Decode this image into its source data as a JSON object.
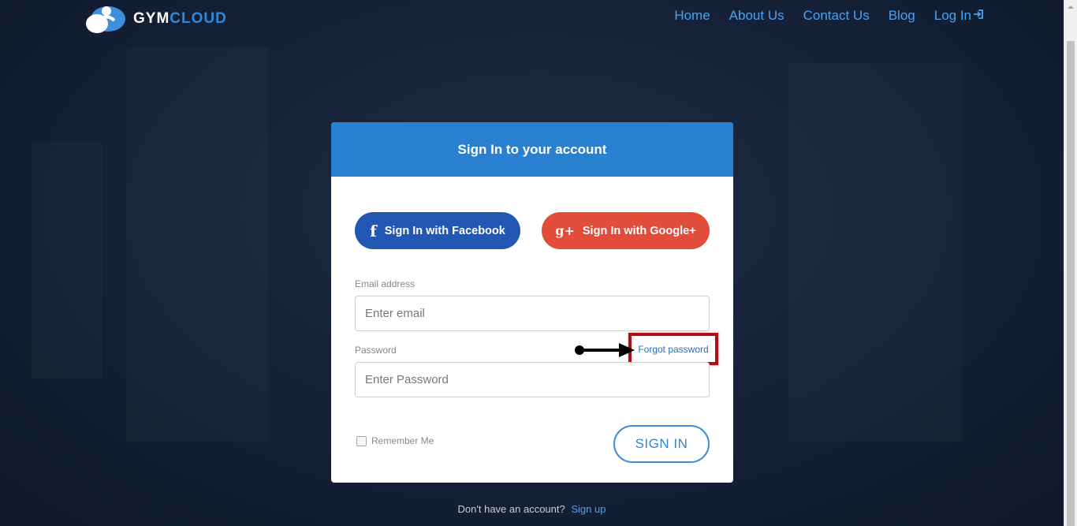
{
  "brand": {
    "name_part1": "GYM",
    "name_part2": "CLOUD"
  },
  "nav": {
    "home": "Home",
    "about": "About Us",
    "contact": "Contact Us",
    "blog": "Blog",
    "login": "Log In"
  },
  "card": {
    "title": "Sign In to your account",
    "facebook_label": "Sign In with Facebook",
    "google_label": "Sign In with Google+",
    "email_label": "Email address",
    "email_placeholder": "Enter email",
    "password_label": "Password",
    "password_placeholder": "Enter Password",
    "forgot_label": "Forgot password",
    "remember_label": "Remember Me",
    "signin_label": "SIGN IN"
  },
  "footer": {
    "prompt": "Don't have an account?",
    "signup_label": "Sign up"
  },
  "colors": {
    "header_blue": "#2a80d0",
    "facebook": "#2357b4",
    "google": "#e24c3b",
    "link_blue": "#4aa3f0",
    "highlight_red": "#b20e18"
  },
  "icons": [
    "logo-icon",
    "login-icon",
    "facebook-icon",
    "google-plus-icon",
    "arrow-annotation-icon"
  ]
}
